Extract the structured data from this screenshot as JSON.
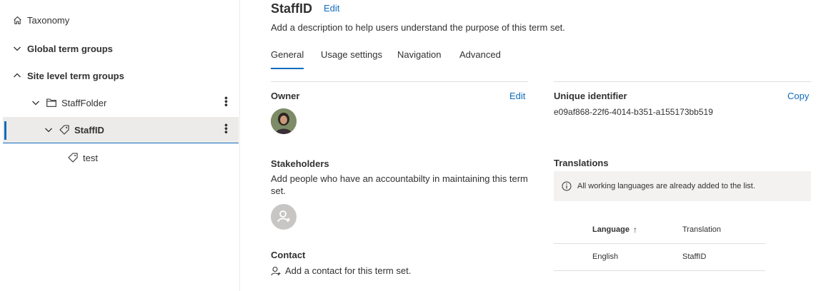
{
  "sidebar": {
    "taxonomy": "Taxonomy",
    "global_groups": "Global term groups",
    "site_groups": "Site level term groups",
    "folder": "StaffFolder",
    "termset": "StaffID",
    "term": "test"
  },
  "header": {
    "title": "StaffID",
    "edit": "Edit",
    "description": "Add a description to help users understand the purpose of this term set."
  },
  "tabs": [
    "General",
    "Usage settings",
    "Navigation",
    "Advanced"
  ],
  "owner": {
    "label": "Owner",
    "edit": "Edit"
  },
  "stakeholders": {
    "label": "Stakeholders",
    "description": "Add people who have an accountabilty in maintaining this term set."
  },
  "contact": {
    "label": "Contact",
    "add": "Add a contact for this term set."
  },
  "identifier": {
    "label": "Unique identifier",
    "copy": "Copy",
    "value": "e09af868-22f6-4014-b351-a155173bb519"
  },
  "translations": {
    "label": "Translations",
    "info": "All working languages are already added to the list.",
    "col_language": "Language",
    "sort_icon": "↑",
    "col_translation": "Translation",
    "rows": [
      {
        "language": "English",
        "translation": "StaffID"
      }
    ]
  },
  "colors": {
    "accent": "#0f6cbd"
  }
}
